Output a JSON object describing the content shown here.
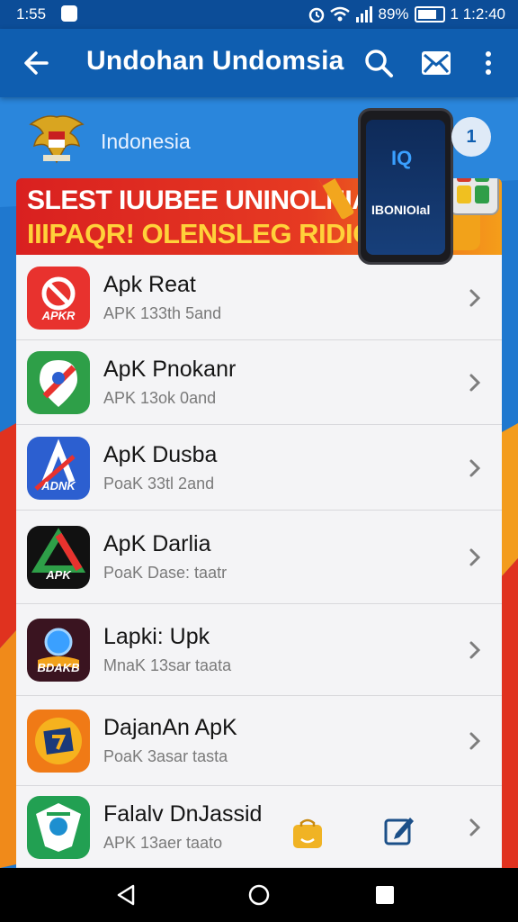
{
  "status_bar": {
    "time": "1:55",
    "battery": "89%",
    "battery_level": 0.89,
    "clock_right": "1 1:2:40"
  },
  "app_bar": {
    "title": "Undohan Undomsia",
    "icons": [
      "back-arrow-icon",
      "search-icon",
      "mail-icon",
      "more-vert-icon"
    ]
  },
  "banner": {
    "country": "Indonesia",
    "promo_line1": "SLEST IUUBEE UNINOLNIANT",
    "promo_line2": "IIIPAQR! OLENSLEG RIDIO",
    "phone_brand": "IBONIOIal",
    "phone_logo": "IQ",
    "info_badge": "1",
    "colors": {
      "red": "#d92020",
      "yellow": "#ffd23a",
      "blue": "#1e73c8"
    }
  },
  "apps": [
    {
      "name": "Apk Reat",
      "sub": "APK 133th 5and",
      "icon_label": "APKR",
      "icon": "no-sign-app-icon",
      "color": "#e8322e"
    },
    {
      "name": "ApK Pnokanr",
      "sub": "APK 13ok 0and",
      "icon_label": "",
      "icon": "map-pin-app-icon",
      "color": "#2e9f48"
    },
    {
      "name": "ApK Dusba",
      "sub": "PoaK 33tl 2and",
      "icon_label": "ADNK",
      "icon": "apk-a-app-icon",
      "color": "#2c5fd0"
    },
    {
      "name": "ApK Darlia",
      "sub": "PoaK Dase: taatr",
      "icon_label": "APK",
      "icon": "triangle-app-icon",
      "color": "#111111"
    },
    {
      "name": "Lapki: Upk",
      "sub": "MnaK 13sar taata",
      "icon_label": "BDAKB",
      "icon": "globe-app-icon",
      "color": "#3a1420"
    },
    {
      "name": "DajanAn ApK",
      "sub": "PoaK 3asar tasta",
      "icon_label": "",
      "icon": "sunburst-app-icon",
      "color": "#f07a16"
    },
    {
      "name": "Falalv DnJassid",
      "sub": "APK 13aer taato",
      "icon_label": "",
      "icon": "shield-app-icon",
      "color": "#22a052"
    }
  ],
  "floating_icons": [
    "shopping-bag-icon",
    "edit-icon"
  ],
  "nav_bar": [
    "nav-back-icon",
    "nav-home-icon",
    "nav-recents-icon"
  ]
}
